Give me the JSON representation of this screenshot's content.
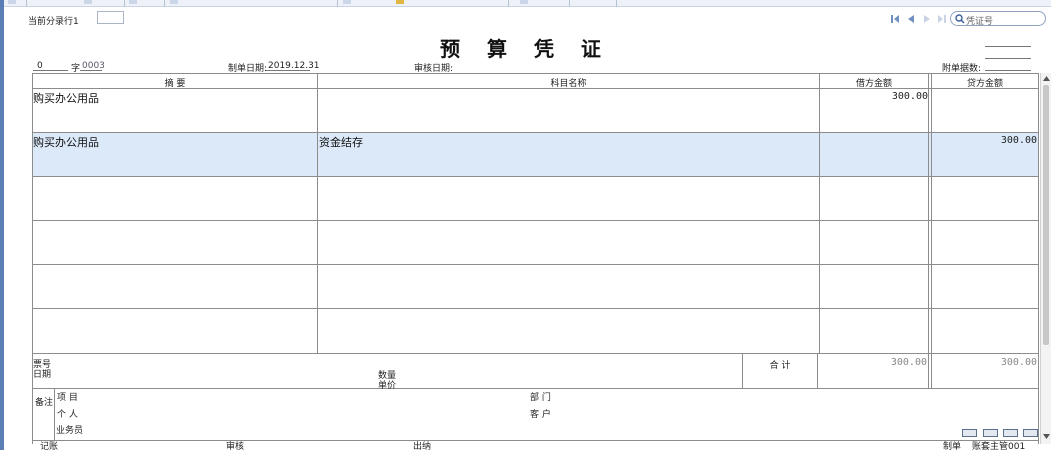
{
  "toolbar": {
    "current_row_label": "当前分录行1",
    "search_placeholder": "凭证号"
  },
  "voucher": {
    "title": "预 算 凭 证",
    "number": "0",
    "zi_label": "字",
    "voucher_no": "0003",
    "date_label": "制单日期:",
    "date": "2019.12.31",
    "audit_date_label": "审核日期:",
    "attachments_label": "附单据数:"
  },
  "columns": {
    "summary": "摘 要",
    "account": "科目名称",
    "debit": "借方金额",
    "credit": "贷方金额"
  },
  "entries": [
    {
      "summary": "购买办公用品",
      "account": "",
      "debit": "300.00",
      "credit": ""
    },
    {
      "summary": "购买办公用品",
      "account": "资金结存",
      "debit": "",
      "credit": "300.00"
    },
    {
      "summary": "",
      "account": "",
      "debit": "",
      "credit": ""
    },
    {
      "summary": "",
      "account": "",
      "debit": "",
      "credit": ""
    },
    {
      "summary": "",
      "account": "",
      "debit": "",
      "credit": ""
    },
    {
      "summary": "",
      "account": "",
      "debit": "",
      "credit": ""
    }
  ],
  "totals": {
    "ticket_no_label": "票号",
    "date_label": "日期",
    "quantity_label": "数量",
    "unit_label": "单价",
    "total_label": "合 计",
    "debit_total": "300.00",
    "credit_total": "300.00"
  },
  "notes": {
    "label": "备注",
    "project_label": "项 目",
    "person_label": "个 人",
    "salesperson_label": "业务员",
    "department_label": "部 门",
    "customer_label": "客 户"
  },
  "signatures": {
    "bookkeeping_label": "记账",
    "review_label": "审核",
    "cashier_label": "出纳",
    "maker_label": "制单",
    "maker_name": "账套主管001"
  },
  "colors": {
    "selected_row": "#dce9f8",
    "accent": "#5b7fb5"
  }
}
